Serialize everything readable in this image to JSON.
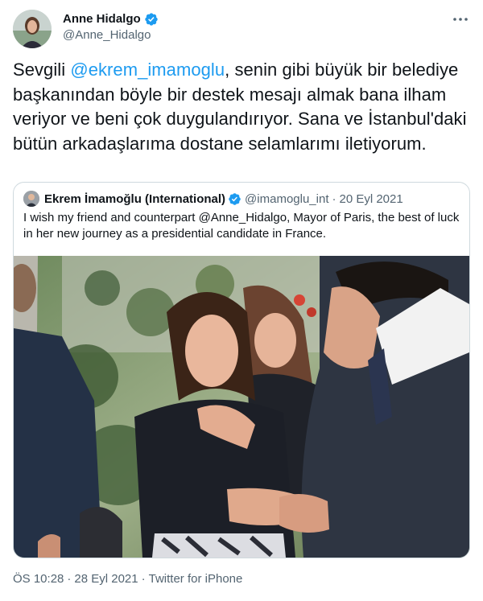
{
  "author": {
    "name": "Anne Hidalgo",
    "handle": "@Anne_Hidalgo",
    "avatar_icon": "profile-photo",
    "verified_icon": "verified-badge-icon"
  },
  "tweet": {
    "text_before": "Sevgili ",
    "mention": "@ekrem_imamoglu",
    "text_after": ", senin gibi büyük bir belediye başkanından böyle bir destek mesajı almak bana ilham veriyor ve beni çok duygulandırıyor. Sana ve İstanbul'daki bütün arkadaşlarıma dostane selamlarımı iletiyorum."
  },
  "quote": {
    "name": "Ekrem İmamoğlu (International)",
    "handle": "@imamoglu_int",
    "separator": "·",
    "date": "20 Eyl 2021",
    "text": "I wish my friend and counterpart @Anne_Hidalgo, Mayor of Paris, the best of luck in her new journey as a presidential candidate in France."
  },
  "meta": {
    "time": "ÖS 10:28",
    "sep1": "·",
    "date": "28 Eyl 2021",
    "sep2": "·",
    "source": "Twitter for iPhone"
  },
  "colors": {
    "accent": "#1d9bf0",
    "text": "#0f1419",
    "secondary": "#536471",
    "border": "#cfd9de"
  }
}
